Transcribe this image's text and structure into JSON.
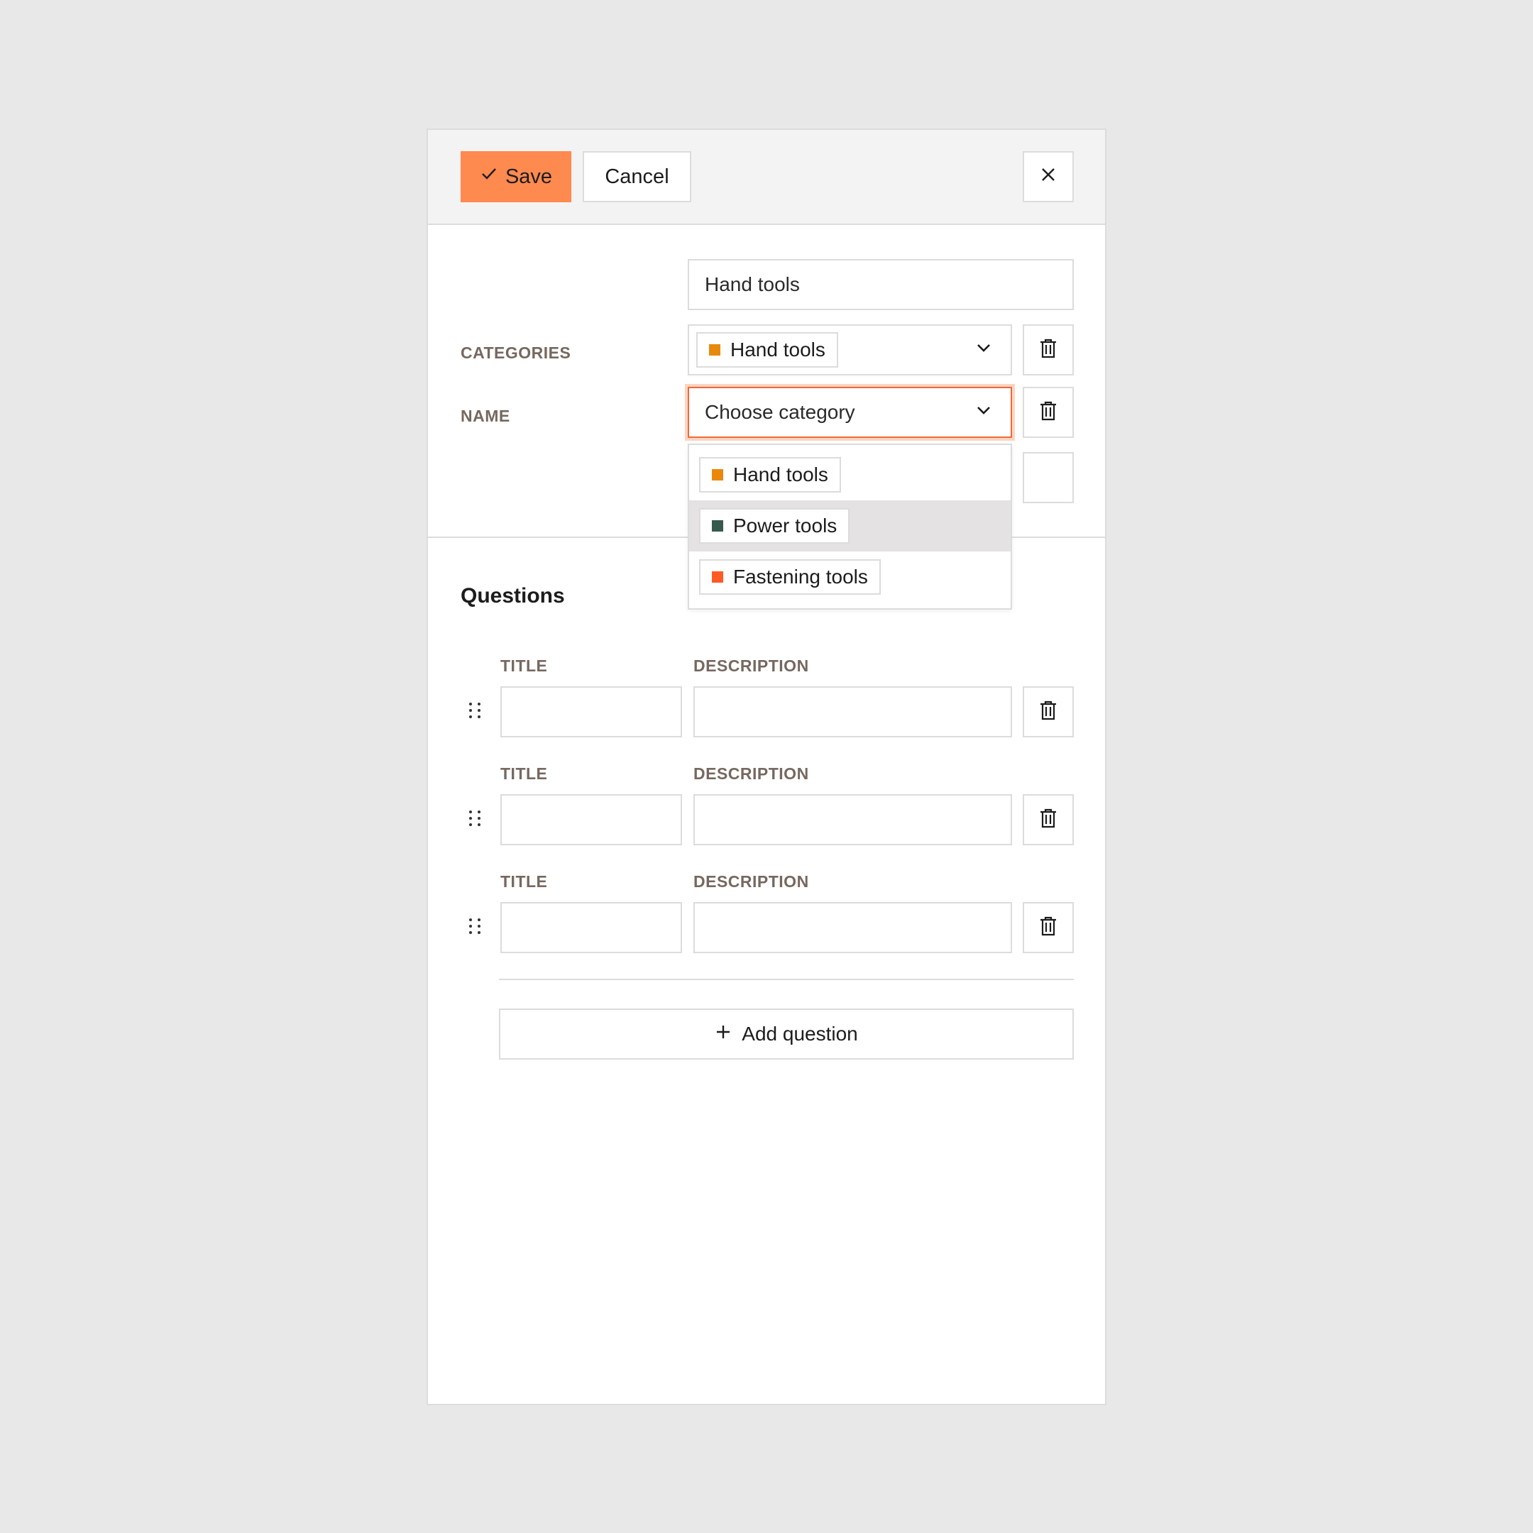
{
  "toolbar": {
    "save_label": "Save",
    "cancel_label": "Cancel"
  },
  "form": {
    "name_label": "NAME",
    "name_value": "Hand tools",
    "categories_label": "CATEGORIES",
    "categories": [
      {
        "label": "Hand tools",
        "color": "#e8890c"
      }
    ],
    "new_category_placeholder": "Choose category"
  },
  "dropdown": {
    "options": [
      {
        "label": "Hand tools",
        "color": "#e8890c"
      },
      {
        "label": "Power tools",
        "color": "#365a4c"
      },
      {
        "label": "Fastening tools",
        "color": "#ff5a26"
      }
    ],
    "highlighted_index": 1
  },
  "questions": {
    "section_title": "Questions",
    "title_label": "TITLE",
    "description_label": "DESCRIPTION",
    "rows": [
      {
        "title": "",
        "description": ""
      },
      {
        "title": "",
        "description": ""
      },
      {
        "title": "",
        "description": ""
      }
    ],
    "add_label": "Add question"
  },
  "colors": {
    "accent": "#ff8a4f",
    "focus_border": "#ef6a3a",
    "label": "#76685f"
  }
}
